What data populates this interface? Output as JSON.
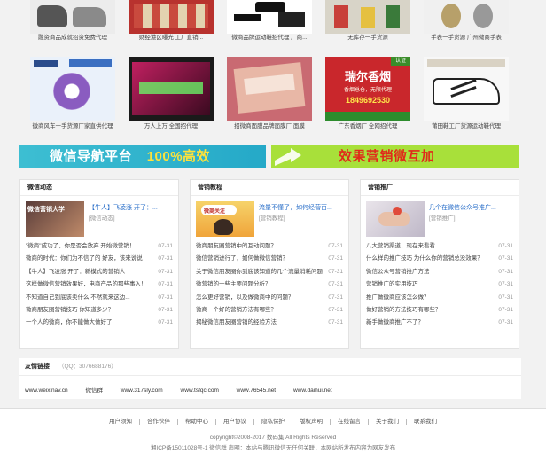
{
  "products_row1": [
    {
      "caption": "融资商品成就招资免费代理"
    },
    {
      "caption": "财经港区曝光 工厂直销..."
    },
    {
      "caption": "微商品牌运动鞋招代理 厂商..."
    },
    {
      "caption": "无库存一手货源"
    },
    {
      "caption": "手表一手货源 广州微商手表"
    }
  ],
  "products_row2": [
    {
      "caption": "微商风车一手货源厂家直供代理",
      "img_text": ""
    },
    {
      "caption": "万人上万  全国招代理",
      "img_text": ""
    },
    {
      "caption": "招微商面膜品牌面膜厂 面膜",
      "img_text": ""
    },
    {
      "caption": "广东香烟厂 全网招代理",
      "img_text": "瑞尔香烟",
      "img_sub": "香烟总仓，无限代理",
      "img_phone": "1849692530",
      "img_badge": "认证"
    },
    {
      "caption": "莆田鞋工厂货源运动鞋代理",
      "img_text": ""
    }
  ],
  "banners": {
    "left": {
      "text": "微信导航平台",
      "accent": "100%高效"
    },
    "right": {
      "text": "效果营销微互加"
    }
  },
  "panels": [
    {
      "title": "微信动态",
      "feature_title": "【牛人】飞凌涨 开了：...",
      "feature_desc": "[微信动态]",
      "feature_img_text": "微信营销大学",
      "items": [
        {
          "text": "\"微商\"成功了，你是否会放弃 开始微营销！",
          "date": "07-31"
        },
        {
          "text": "微商的时代：你们为不信了的 好友，该来说说！",
          "date": "07-31"
        },
        {
          "text": "【牛人】飞凌涨 开了：新模式的营销人",
          "date": "07-31"
        },
        {
          "text": "这样做微信营销效果好，电商产品的那些事入！",
          "date": "07-31"
        },
        {
          "text": "不知道自己到底该卖什么 不然就来这边...",
          "date": "07-31"
        },
        {
          "text": "微商朋友圈营销技巧 你知道多少？",
          "date": "07-31"
        },
        {
          "text": "一个人的微商，你不能做大做好了",
          "date": "07-31"
        }
      ]
    },
    {
      "title": "营销教程",
      "feature_title": "流量不懂了，如何经营百...",
      "feature_desc": "[营销教程]",
      "feature_img_text": "微商关注",
      "items": [
        {
          "text": "微商朋友圈营销中的互动问题？",
          "date": "07-31"
        },
        {
          "text": "微信营销进行了，如何做微信营销？",
          "date": "07-31"
        },
        {
          "text": "关于微信朋友圈你到底该知道的几个流量消耗问题",
          "date": "07-31"
        },
        {
          "text": "微营销的一些主要问题分析？",
          "date": "07-31"
        },
        {
          "text": "怎么更好营销，以及做微商中的问题？",
          "date": "07-31"
        },
        {
          "text": "微商一个好的营销方法有哪些？",
          "date": "07-31"
        },
        {
          "text": "揭秘微信朋友圈营销的经验方法",
          "date": "07-31"
        }
      ]
    },
    {
      "title": "营销推广",
      "feature_title": "几个在微信公众号推广...",
      "feature_desc": "[营销推广]",
      "feature_img_text": "",
      "items": [
        {
          "text": "八大营销渠道，现在来看看",
          "date": "07-31"
        },
        {
          "text": "什么样的推广技巧 为什么你的营销总没效果？",
          "date": "07-31"
        },
        {
          "text": "微信公众号营销推广方法",
          "date": "07-31"
        },
        {
          "text": "营销推广的实用技巧",
          "date": "07-31"
        },
        {
          "text": "推广做微商应该怎么做？",
          "date": "07-31"
        },
        {
          "text": "做好营销的方法技巧有哪些？",
          "date": "07-31"
        },
        {
          "text": "新手做微商推广不了？",
          "date": "07-31"
        }
      ]
    }
  ],
  "links": {
    "title": "友情链接",
    "qq": "（QQ：3076688176）",
    "items": [
      "www.weixinav.cn",
      "微信群",
      "www.317sly.com",
      "www.tsfqc.com",
      "www.76545.net",
      "www.daihui.net"
    ]
  },
  "footer": {
    "nav": [
      "用户须知",
      "合作伙伴",
      "帮助中心",
      "用户协议",
      "隐私保护",
      "版权声明",
      "在线留言",
      "关于我们",
      "联系我们"
    ],
    "copyright": "copyright©2008-2017 数码集.All Rights Reserved",
    "icp": "湘ICP备15011028号-1 微信群   声明：本站与腾讯微信无任何关联，本网站所发布内容为网友发布"
  }
}
